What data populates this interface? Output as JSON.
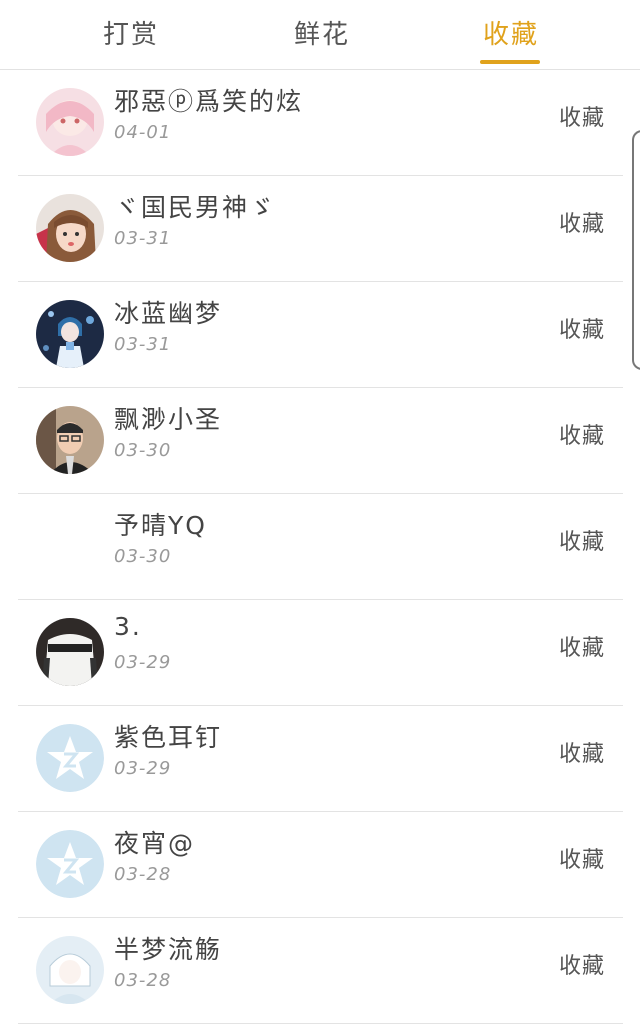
{
  "tabs": {
    "tip": "打赏",
    "flowers": "鲜花",
    "favorites": "收藏",
    "active_color": "#e0a21c"
  },
  "rows": [
    {
      "name": "邪惡ⓟ爲笑的炫",
      "date": "04-01",
      "action": "收藏",
      "avatar": "anime-girl-pink"
    },
    {
      "name": "ヾ国民男神ゞ",
      "date": "03-31",
      "action": "收藏",
      "avatar": "girl-brown-hair"
    },
    {
      "name": "冰蓝幽梦",
      "date": "03-31",
      "action": "收藏",
      "avatar": "anime-blue-night"
    },
    {
      "name": "飘渺小圣",
      "date": "03-30",
      "action": "收藏",
      "avatar": "man-glasses"
    },
    {
      "name": "予晴YQ",
      "date": "03-30",
      "action": "收藏",
      "avatar": "none"
    },
    {
      "name": "3.",
      "date": "03-29",
      "action": "收藏",
      "avatar": "sweater-shirt"
    },
    {
      "name": "紫色耳钉",
      "date": "03-29",
      "action": "收藏",
      "avatar": "default-star"
    },
    {
      "name": "夜宵@",
      "date": "03-28",
      "action": "收藏",
      "avatar": "default-star"
    },
    {
      "name": "半梦流觞",
      "date": "03-28",
      "action": "收藏",
      "avatar": "anime-white"
    }
  ]
}
